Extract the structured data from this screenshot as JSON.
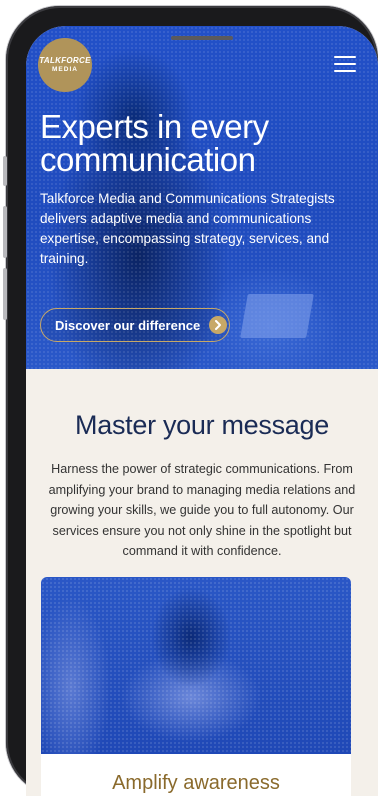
{
  "header": {
    "logo_line1": "TALKFORCE",
    "logo_line2": "MEDIA",
    "menu_icon": "hamburger-menu-icon"
  },
  "hero": {
    "title": "Experts in every communication",
    "description": "Talkforce Media and Communications Strategists delivers adaptive media and communications expertise, encompassing strategy, services, and training.",
    "cta_label": "Discover our difference",
    "cta_icon": "chevron-right-icon"
  },
  "section": {
    "title": "Master your message",
    "description": "Harness the power of strategic communications. From amplifying your brand to managing media relations and growing your skills, we guide you to full autonomy. Our services ensure you not only shine in the spotlight but command it with confidence."
  },
  "card": {
    "title": "Amplify awareness"
  },
  "colors": {
    "hero_blue": "#2250c8",
    "gold": "#b0945a",
    "navy": "#1a2b55",
    "cream": "#f4f0ea"
  }
}
